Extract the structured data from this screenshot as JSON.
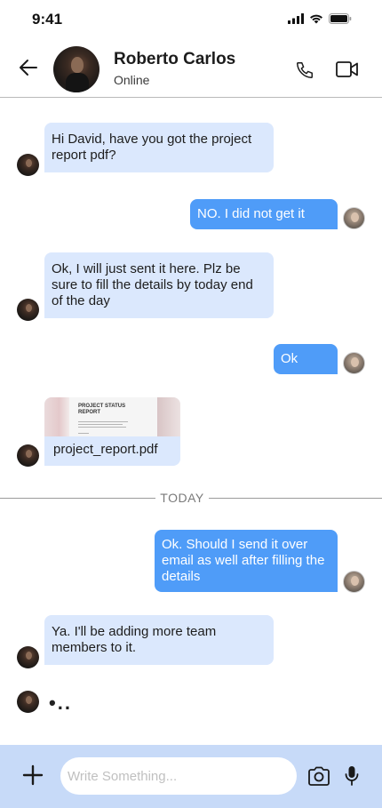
{
  "status_bar": {
    "time": "9:41"
  },
  "header": {
    "contact_name": "Roberto Carlos",
    "contact_status": "Online"
  },
  "messages": [
    {
      "direction": "in",
      "text": "Hi David, have you got the project report pdf?"
    },
    {
      "direction": "out",
      "text": "NO. I did not get it"
    },
    {
      "direction": "in",
      "text": "Ok, I will just sent it here. Plz be sure to fill the details by today end of the day"
    },
    {
      "direction": "out",
      "text": "Ok"
    },
    {
      "direction": "in",
      "type": "file",
      "file_name": "project_report.pdf",
      "thumb_title": "PROJECT STATUS REPORT"
    },
    {
      "direction": "out",
      "text": "Ok. Should I send it over email as well after filling the details"
    },
    {
      "direction": "in",
      "text": "Ya. I'll be adding more team members to it."
    }
  ],
  "divider": {
    "label": "TODAY"
  },
  "typing_indicator": "•..",
  "composer": {
    "placeholder": "Write Something..."
  },
  "colors": {
    "incoming_bubble": "#dbe8fd",
    "outgoing_bubble": "#4f9cf8",
    "composer_bg": "#c7daf8"
  }
}
